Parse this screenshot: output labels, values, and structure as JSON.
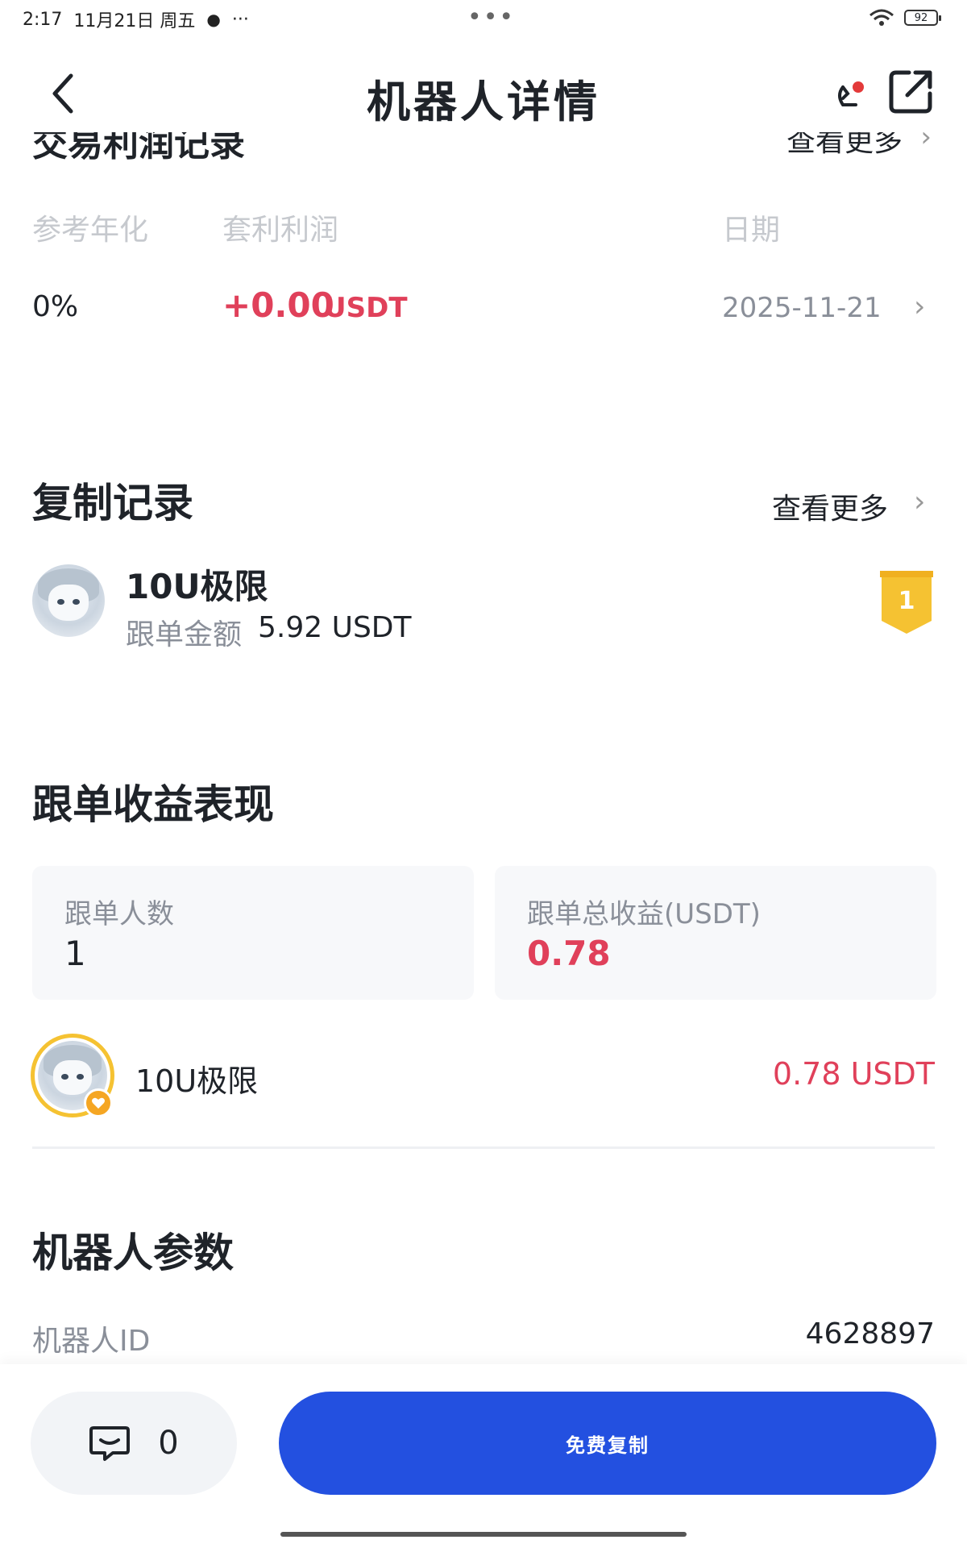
{
  "status_bar": {
    "time": "2:17",
    "date": "11月21日 周五",
    "extra": "···",
    "center_dots": "•••",
    "battery": "92"
  },
  "nav": {
    "title": "机器人详情",
    "back_icon": "chevron-left-icon",
    "action_icon_1": "alert-bell-icon",
    "action_icon_2": "share-icon"
  },
  "trade_records": {
    "partial_title": "交易利润记录",
    "more": "查看更多",
    "headers": [
      "参考年化",
      "套利利润",
      "日期"
    ],
    "rows": [
      {
        "annualized": "0%",
        "profit": "+0.00",
        "unit": "USDT",
        "date": "2025-11-21"
      }
    ]
  },
  "copy_records": {
    "title": "复制记录",
    "more": "查看更多",
    "item": {
      "name": "10U极限",
      "amount_label": "跟单金额",
      "amount_value": "5.92 USDT",
      "rank": "1"
    }
  },
  "follow_performance": {
    "title": "跟单收益表现",
    "followers_label": "跟单人数",
    "followers_value": "1",
    "total_label": "跟单总收益(USDT)",
    "total_value": "0.78",
    "follower": {
      "name": "10U极限",
      "profit": "0.78 USDT"
    }
  },
  "params": {
    "title": "机器人参数",
    "robot_id_label": "机器人ID",
    "robot_id_value": "4628897"
  },
  "bottom": {
    "comment_count": "0",
    "copy_label": "免费复制"
  },
  "colors": {
    "accent_blue": "#2350e0",
    "profit_red": "#e0405a",
    "badge_gold": "#f5c232"
  }
}
